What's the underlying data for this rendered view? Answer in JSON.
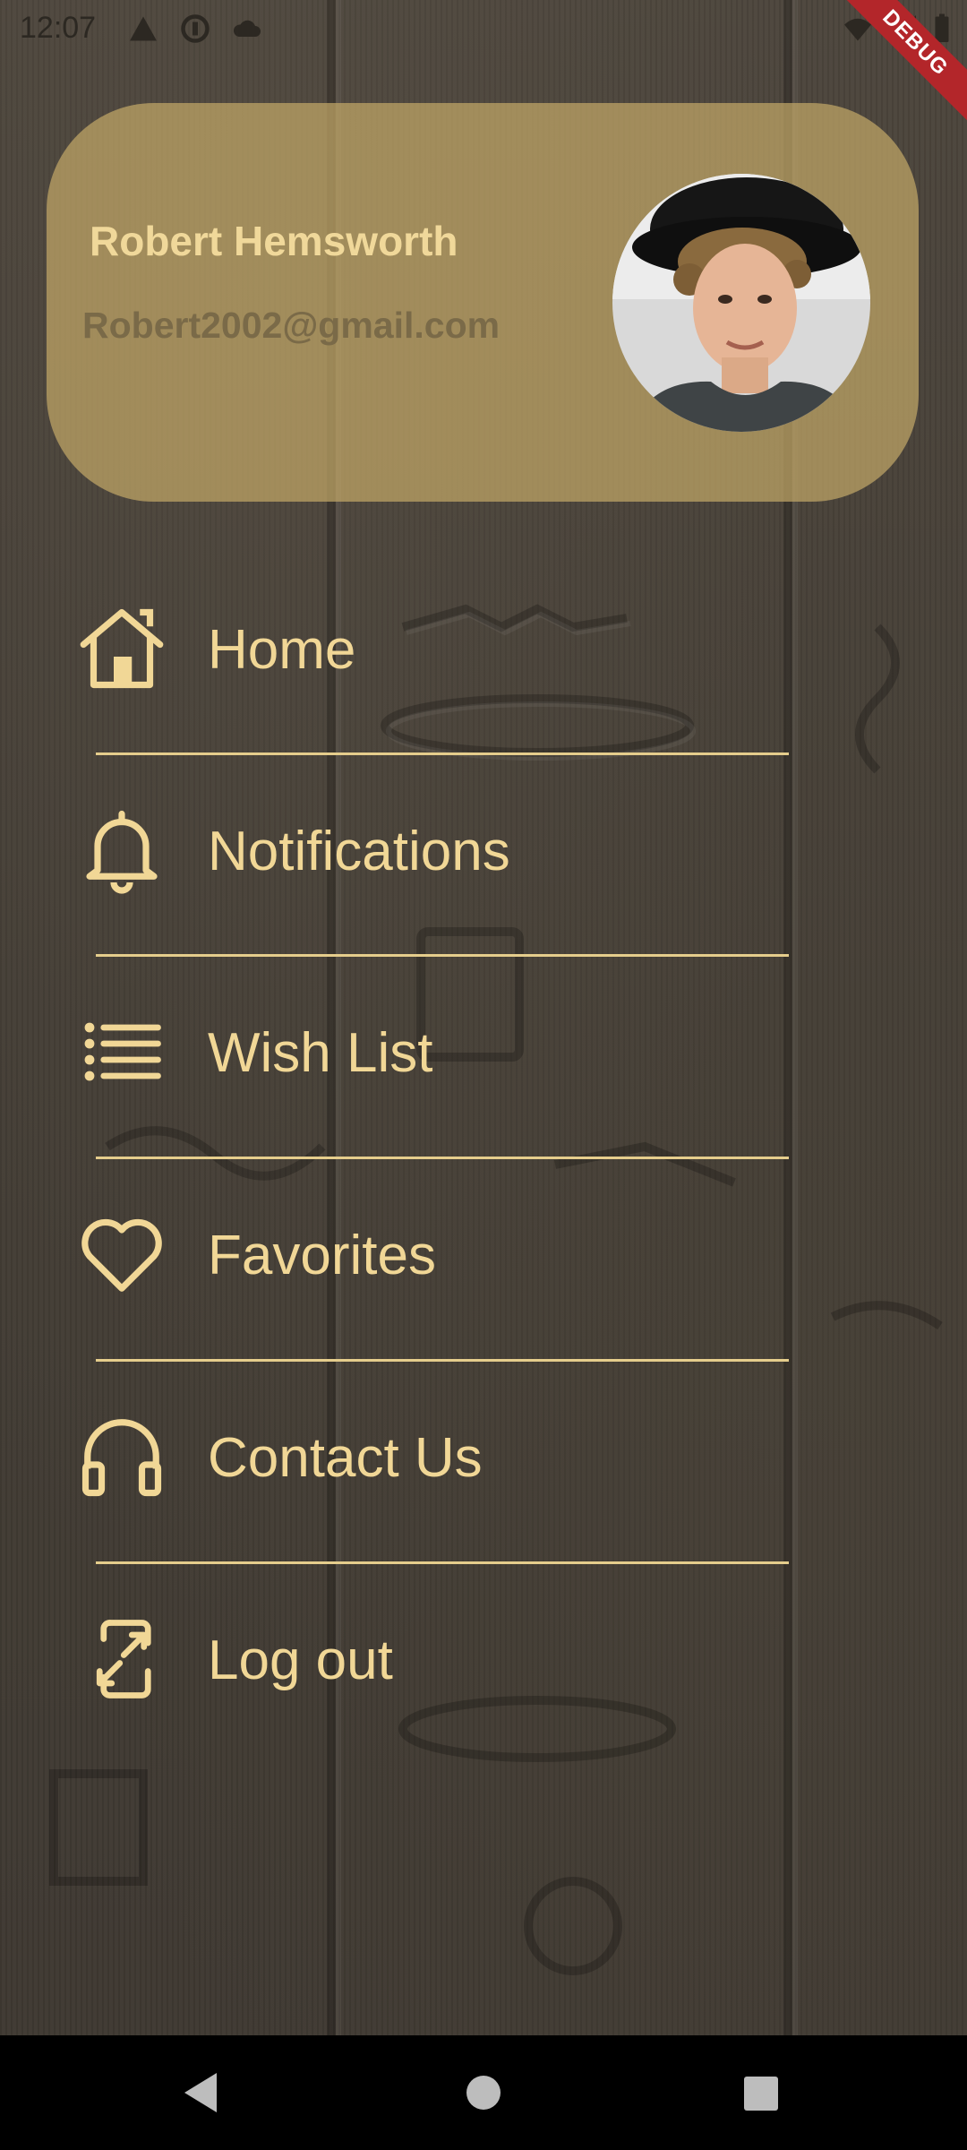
{
  "status_bar": {
    "time": "12:07"
  },
  "debug_banner": {
    "label": "DEBUG"
  },
  "profile": {
    "name": "Robert Hemsworth",
    "email": "Robert2002@gmail.com"
  },
  "menu": [
    {
      "label": "Home",
      "icon": "home-icon"
    },
    {
      "label": "Notifications",
      "icon": "bell-icon"
    },
    {
      "label": "Wish List",
      "icon": "list-icon"
    },
    {
      "label": "Favorites",
      "icon": "heart-icon"
    },
    {
      "label": "Contact Us",
      "icon": "headphones-icon"
    },
    {
      "label": "Log out",
      "icon": "logout-icon"
    }
  ],
  "colors": {
    "accent": "#f1d796",
    "card": "#c4aa68",
    "email": "#7a6a48",
    "background": "#4a443c"
  }
}
